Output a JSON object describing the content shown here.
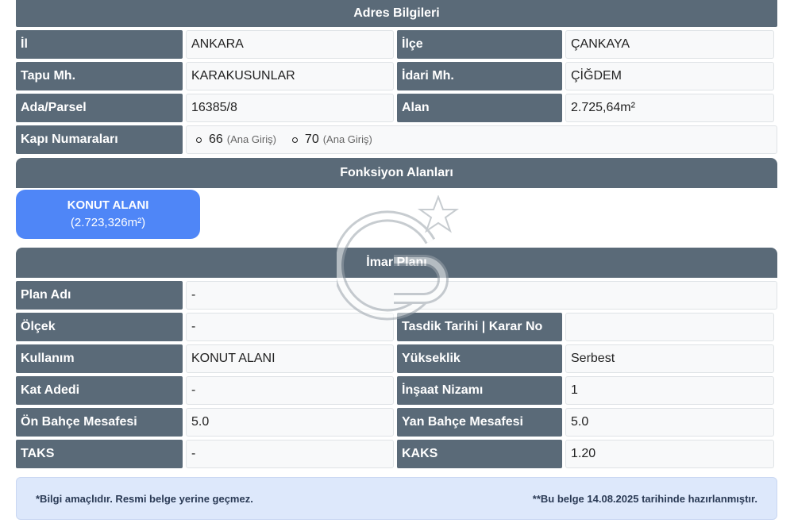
{
  "address": {
    "title": "Adres Bilgileri",
    "il_label": "İl",
    "il_value": "ANKARA",
    "ilce_label": "İlçe",
    "ilce_value": "ÇANKAYA",
    "tapu_label": "Tapu Mh.",
    "tapu_value": "KARAKUSUNLAR",
    "idari_label": "İdari Mh.",
    "idari_value": "ÇİĞDEM",
    "ada_label": "Ada/Parsel",
    "ada_value": "16385/8",
    "alan_label": "Alan",
    "alan_value": "2.725,64m²",
    "kapi_label": "Kapı Numaraları",
    "doors": [
      {
        "number": "66",
        "note": "(Ana Giriş)"
      },
      {
        "number": "70",
        "note": "(Ana Giriş)"
      }
    ]
  },
  "functions": {
    "title": "Fonksiyon Alanları",
    "items": [
      {
        "name": "KONUT ALANI",
        "area": "(2.723,326m²)"
      }
    ]
  },
  "plan": {
    "title": "İmar Planı",
    "plan_adi_label": "Plan Adı",
    "plan_adi_value": "-",
    "olcek_label": "Ölçek",
    "olcek_value": "-",
    "tasdik_label": "Tasdik Tarihi | Karar No",
    "tasdik_value": "",
    "kullanim_label": "Kullanım",
    "kullanim_value": "KONUT ALANI",
    "yukseklik_label": "Yükseklik",
    "yukseklik_value": "Serbest",
    "kat_label": "Kat Adedi",
    "kat_value": "-",
    "insaat_label": "İnşaat Nizamı",
    "insaat_value": "1",
    "on_bahce_label": "Ön Bahçe Mesafesi",
    "on_bahce_value": "5.0",
    "yan_bahce_label": "Yan Bahçe Mesafesi",
    "yan_bahce_value": "5.0",
    "taks_label": "TAKS",
    "taks_value": "-",
    "kaks_label": "KAKS",
    "kaks_value": "1.20"
  },
  "footer": {
    "left": "*Bilgi amaçlıdır. Resmi belge yerine geçmez.",
    "right": "**Bu belge 14.08.2025 tarihinde hazırlanmıştır."
  }
}
